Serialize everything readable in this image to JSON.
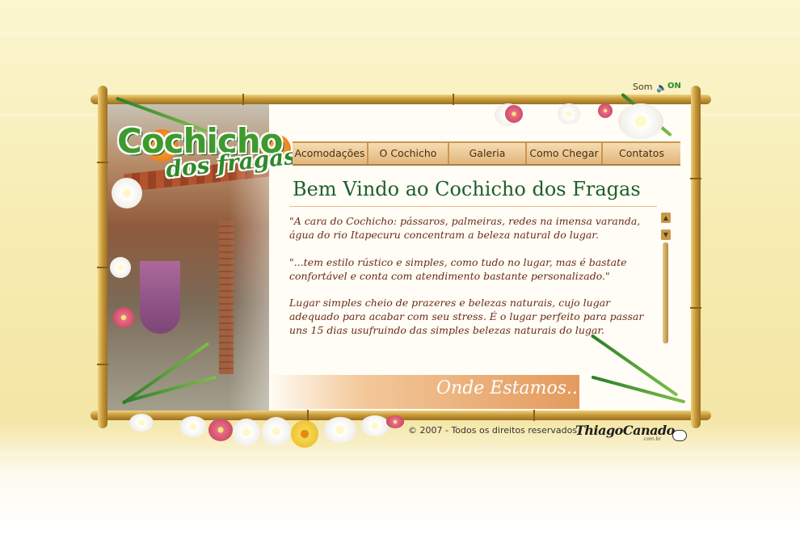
{
  "header": {
    "sound_label": "Som",
    "sound_state": "ON",
    "logo_main": "Cochicho",
    "logo_sub": "dos fragas"
  },
  "nav": {
    "items": [
      {
        "label": "Acomodações"
      },
      {
        "label": "O Cochicho"
      },
      {
        "label": "Galeria"
      },
      {
        "label": "Como Chegar"
      },
      {
        "label": "Contatos"
      }
    ]
  },
  "content": {
    "title": "Bem Vindo ao Cochicho dos Fragas",
    "paragraphs": [
      "\"A cara do Cochicho: pássaros, palmeiras, redes na imensa varanda, água do rio Itapecuru concentram a beleza natural do lugar.",
      "\"...tem estilo rústico e simples, como tudo no lugar, mas é bastate confortável e conta com atendimento bastante personalizado.\"",
      "Lugar simples cheio de prazeres e belezas naturais, cujo lugar adequado para acabar com seu stress. É o lugar perfeito para passar  uns 15 dias usufruindo das simples belezas naturais do lugar."
    ],
    "location_link": "Onde Estamos..."
  },
  "footer": {
    "copyright": "© 2007 - Todos os direitos reservados",
    "credit": "ThiagoCanado",
    "credit_domain": ".com.br"
  },
  "icons": {
    "speaker": "speaker-icon",
    "scroll_up": "scroll-up-icon",
    "scroll_down": "scroll-down-icon",
    "mouse": "mouse-icon"
  },
  "colors": {
    "accent_green": "#1e5e2c",
    "text_brown": "#6a2a14",
    "bamboo": "#c99c3c"
  }
}
